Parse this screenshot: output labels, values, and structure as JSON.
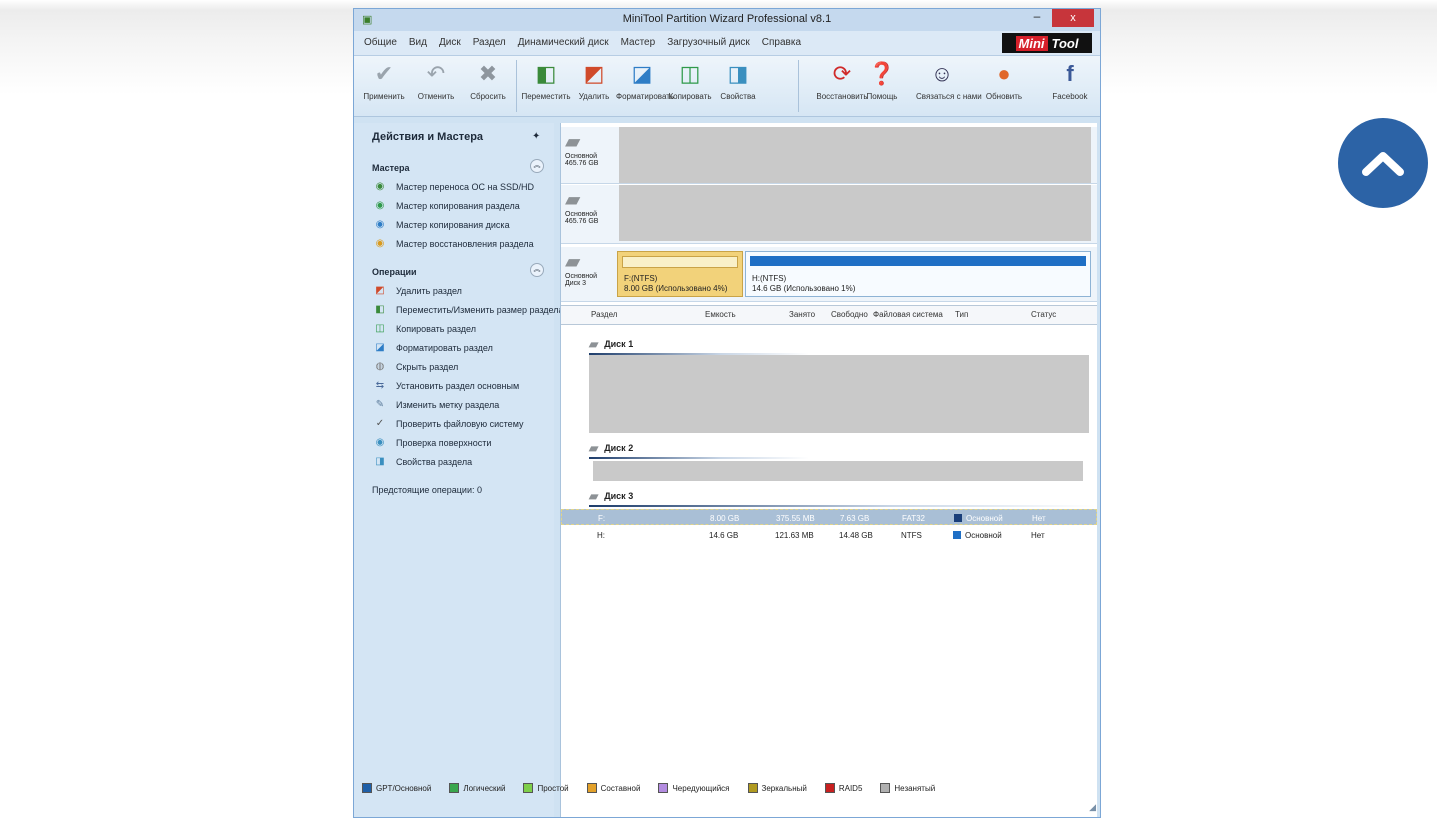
{
  "window": {
    "title": "MiniTool Partition Wizard Professional v8.1",
    "minimize": "–",
    "close": "x",
    "app_icon": "partition-wizard-icon"
  },
  "menu": {
    "items": [
      "Общие",
      "Вид",
      "Диск",
      "Раздел",
      "Динамический диск",
      "Мастер",
      "Загрузочный диск",
      "Справка"
    ],
    "brand_part1": "Mini",
    "brand_part2": "Tool"
  },
  "toolbar": {
    "buttons": [
      {
        "label": "Применить",
        "icon": "checkmark-icon"
      },
      {
        "label": "Отменить",
        "icon": "undo-icon"
      },
      {
        "label": "Сбросить",
        "icon": "discard-icon"
      },
      {
        "label": "Переместить",
        "icon": "move-resize-icon"
      },
      {
        "label": "Удалить",
        "icon": "delete-icon"
      },
      {
        "label": "Форматировать",
        "icon": "format-icon"
      },
      {
        "label": "Копировать",
        "icon": "copy-icon"
      },
      {
        "label": "Свойства",
        "icon": "properties-icon"
      },
      {
        "label": "Восстановить",
        "icon": "recovery-icon"
      },
      {
        "label": "Помощь",
        "icon": "help-icon"
      },
      {
        "label": "Связаться с нами",
        "icon": "contact-icon"
      },
      {
        "label": "Обновить",
        "icon": "upgrade-icon"
      },
      {
        "label": "Facebook",
        "icon": "facebook-icon"
      }
    ]
  },
  "sidebar": {
    "title": "Действия и Мастера",
    "groups": [
      {
        "label": "Мастера",
        "items": [
          "Мастер переноса ОС на SSD/HD",
          "Мастер копирования раздела",
          "Мастер копирования диска",
          "Мастер восстановления раздела"
        ]
      },
      {
        "label": "Операции",
        "items": [
          "Удалить раздел",
          "Переместить/Изменить размер раздела",
          "Копировать раздел",
          "Форматировать раздел",
          "Скрыть раздел",
          "Установить раздел основным",
          "Изменить метку раздела",
          "Проверить файловую систему",
          "Проверка поверхности",
          "Свойства раздела"
        ]
      }
    ],
    "pending": "Предстоящие операции: 0"
  },
  "disks_map": [
    {
      "label": "Основной",
      "sub": "465.76 GB"
    },
    {
      "label": "Основной",
      "sub": "465.76 GB"
    },
    {
      "label": "Основной",
      "sub": "Диск 3",
      "partitions": [
        {
          "name": "F:(NTFS)",
          "detail": "8.00 GB (Использовано 4%)"
        },
        {
          "name": "H:(NTFS)",
          "detail": "14.6 GB (Использовано 1%)"
        }
      ]
    }
  ],
  "table": {
    "columns": [
      "Раздел",
      "Емкость",
      "Занято",
      "Свободно",
      "Файловая система",
      "Тип",
      "Статус"
    ],
    "groups": [
      {
        "name": "Диск 1"
      },
      {
        "name": "Диск 2"
      },
      {
        "name": "Диск 3",
        "rows": [
          {
            "partition": "F:",
            "capacity": "8.00 GB",
            "used": "375.55 MB",
            "unused": "7.63 GB",
            "fs": "FAT32",
            "type": "Основной",
            "status": "Нет",
            "color": "#1a3f7a"
          },
          {
            "partition": "H:",
            "capacity": "14.6 GB",
            "used": "121.63 MB",
            "unused": "14.48 GB",
            "fs": "NTFS",
            "type": "Основной",
            "status": "Нет",
            "color": "#1f6fc5"
          }
        ]
      }
    ]
  },
  "legend": [
    {
      "label": "GPT/Основной",
      "color": "#1e5fa8"
    },
    {
      "label": "Логический",
      "color": "#3aa74d"
    },
    {
      "label": "Простой",
      "color": "#7ecf4a"
    },
    {
      "label": "Составной",
      "color": "#e3a12a"
    },
    {
      "label": "Чередующийся",
      "color": "#b38ce0"
    },
    {
      "label": "Зеркальный",
      "color": "#b09a20"
    },
    {
      "label": "RAID5",
      "color": "#c82020"
    },
    {
      "label": "Незанятый",
      "color": "#b0b0b0"
    }
  ],
  "colors": {
    "scroll_button": "#2c63a6",
    "selected_partition": "#f2d27a"
  }
}
